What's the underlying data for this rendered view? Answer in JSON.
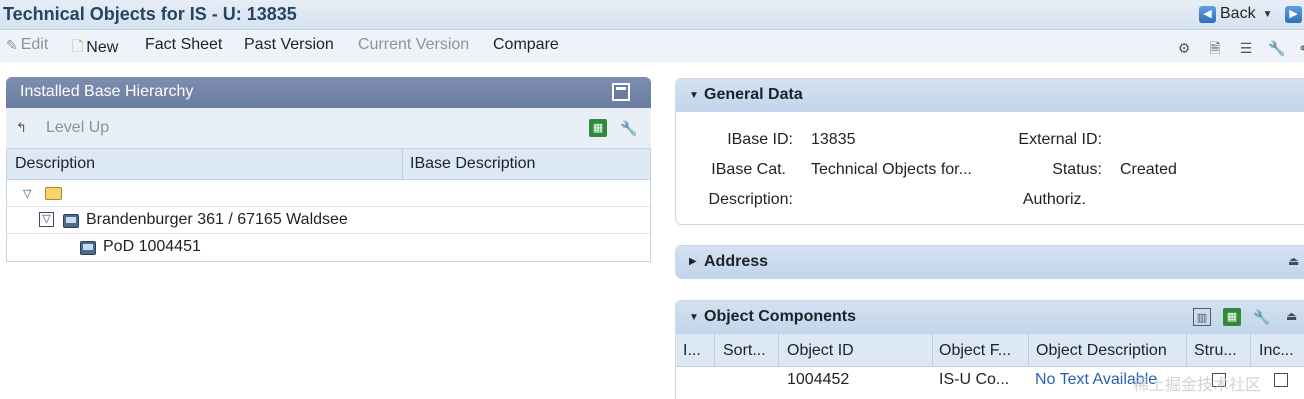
{
  "header": {
    "title": "Technical Objects for IS - U: 13835",
    "back_label": "Back"
  },
  "toolbar": {
    "edit": "Edit",
    "new": "New",
    "fact_sheet": "Fact Sheet",
    "past_version": "Past Version",
    "current_version": "Current Version",
    "compare": "Compare"
  },
  "hierarchy": {
    "title": "Installed Base Hierarchy",
    "level_up": "Level Up",
    "columns": [
      "Description",
      "IBase Description"
    ],
    "rows": [
      {
        "label": ""
      },
      {
        "label": "Brandenburger 361 / 67165 Waldsee"
      },
      {
        "label": "PoD 1004451"
      }
    ]
  },
  "general": {
    "title": "General Data",
    "ibase_id_label": "IBase ID:",
    "ibase_id": "13835",
    "external_id_label": "External ID:",
    "external_id": "",
    "ibase_cat_label": "IBase Cat.",
    "ibase_cat": "Technical Objects for...",
    "status_label": "Status:",
    "status": "Created",
    "description_label": "Description:",
    "description": "",
    "authoriz_label": "Authoriz.",
    "authoriz": ""
  },
  "address": {
    "title": "Address"
  },
  "components": {
    "title": "Object Components",
    "columns": [
      "I...",
      "Sort...",
      "Object ID",
      "Object F...",
      "Object Description",
      "Stru...",
      "Inc..."
    ],
    "row": {
      "object_id": "1004452",
      "object_f": "IS-U Co...",
      "object_description": "No Text Available"
    }
  },
  "watermark": "稀土掘金技术社区"
}
